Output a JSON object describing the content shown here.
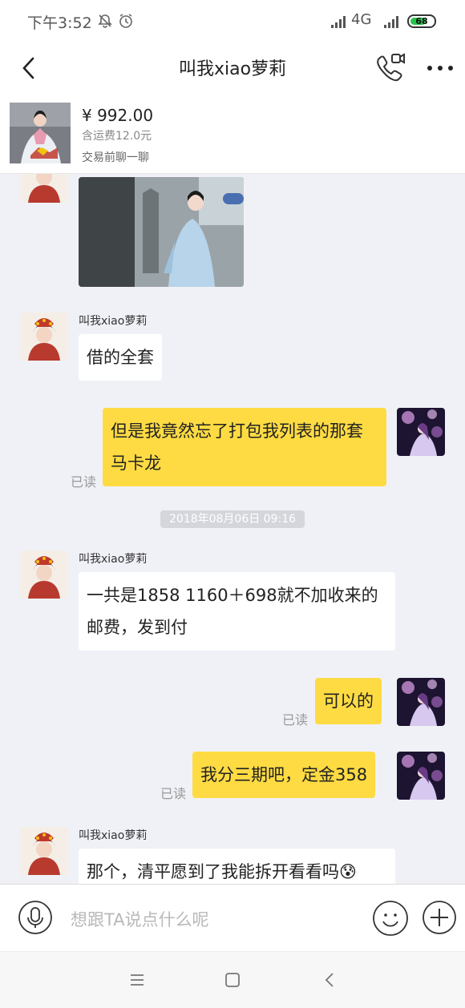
{
  "status_bar": {
    "time": "下午3:52",
    "network": "4G",
    "battery": "68",
    "battery_level": 0.68
  },
  "header": {
    "title": "叫我xiao萝莉",
    "icons": [
      "back-icon",
      "video-call-icon",
      "more-icon"
    ]
  },
  "product": {
    "price": "¥ 992.00",
    "shipping": "含运费12.0元",
    "chat_link": "交易前聊一聊"
  },
  "chat": {
    "messages": [
      {
        "from": "other",
        "type": "image"
      },
      {
        "from": "other",
        "sender": "叫我xiao萝莉",
        "text": "借的全套"
      },
      {
        "from": "me",
        "text": "但是我竟然忘了打包我列表的那套马卡龙",
        "status": "已读"
      },
      {
        "timestamp": "2018年08月06日 09:16"
      },
      {
        "from": "other",
        "sender": "叫我xiao萝莉",
        "text": "一共是1858 1160＋698就不加收来的邮费，发到付"
      },
      {
        "from": "me",
        "text": "可以的",
        "status": "已读"
      },
      {
        "from": "me",
        "text": "我分三期吧，定金358",
        "status": "已读"
      },
      {
        "from": "other",
        "sender": "叫我xiao萝莉",
        "text": "那个，清平愿到了我能拆开看看吗😰"
      }
    ]
  },
  "input_bar": {
    "placeholder": "想跟TA说点什么呢"
  },
  "nav_bar": {
    "icons": [
      "menu-icon",
      "home-icon",
      "back-nav-icon"
    ]
  },
  "colors": {
    "outgoing_bubble": "#fedb43",
    "incoming_bubble": "#ffffff",
    "chat_background": "#f0f1f7"
  }
}
